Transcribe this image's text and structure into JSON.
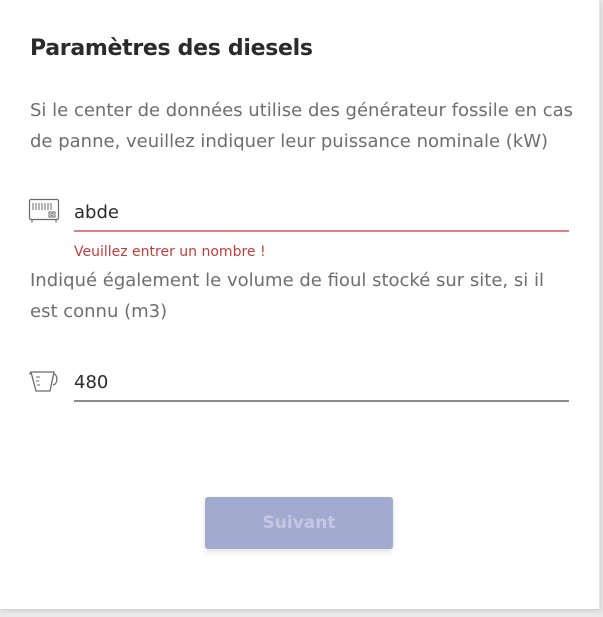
{
  "page_title": "Paramètres des diesels",
  "power_section": {
    "description": "Si le center de données utilise des générateur fossile en cas de panne, veuillez indiquer leur puissance nominale (kW)",
    "icon": "generator-icon",
    "value": "abde",
    "error": "Veuillez entrer un nombre !"
  },
  "volume_section": {
    "description": "Indiqué également le volume de fioul stocké sur site, si il est connu (m3)",
    "icon": "measuring-cup-icon",
    "value": "480"
  },
  "next_button": {
    "label": "Suivant",
    "disabled": true
  },
  "colors": {
    "error": "#c43c3c",
    "error_underline": "#e57f85",
    "button_disabled": "#a3aad0"
  }
}
